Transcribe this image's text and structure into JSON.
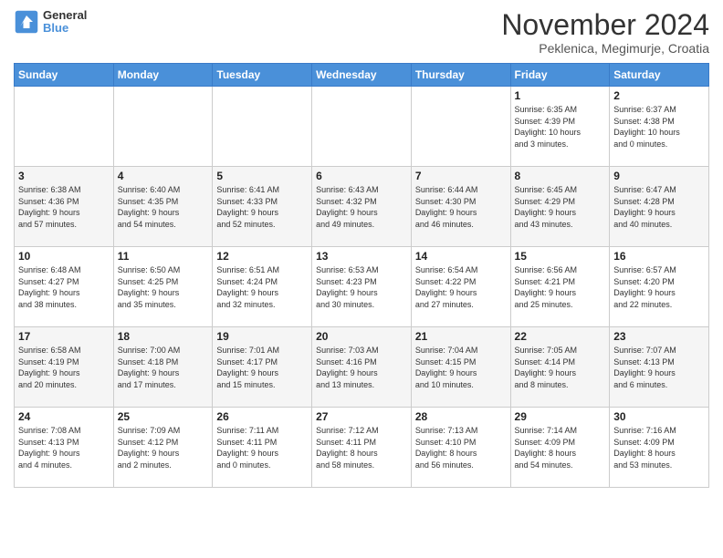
{
  "header": {
    "logo_general": "General",
    "logo_blue": "Blue",
    "month_title": "November 2024",
    "subtitle": "Peklenica, Megimurje, Croatia"
  },
  "days_of_week": [
    "Sunday",
    "Monday",
    "Tuesday",
    "Wednesday",
    "Thursday",
    "Friday",
    "Saturday"
  ],
  "weeks": [
    [
      {
        "day": "",
        "info": ""
      },
      {
        "day": "",
        "info": ""
      },
      {
        "day": "",
        "info": ""
      },
      {
        "day": "",
        "info": ""
      },
      {
        "day": "",
        "info": ""
      },
      {
        "day": "1",
        "info": "Sunrise: 6:35 AM\nSunset: 4:39 PM\nDaylight: 10 hours\nand 3 minutes."
      },
      {
        "day": "2",
        "info": "Sunrise: 6:37 AM\nSunset: 4:38 PM\nDaylight: 10 hours\nand 0 minutes."
      }
    ],
    [
      {
        "day": "3",
        "info": "Sunrise: 6:38 AM\nSunset: 4:36 PM\nDaylight: 9 hours\nand 57 minutes."
      },
      {
        "day": "4",
        "info": "Sunrise: 6:40 AM\nSunset: 4:35 PM\nDaylight: 9 hours\nand 54 minutes."
      },
      {
        "day": "5",
        "info": "Sunrise: 6:41 AM\nSunset: 4:33 PM\nDaylight: 9 hours\nand 52 minutes."
      },
      {
        "day": "6",
        "info": "Sunrise: 6:43 AM\nSunset: 4:32 PM\nDaylight: 9 hours\nand 49 minutes."
      },
      {
        "day": "7",
        "info": "Sunrise: 6:44 AM\nSunset: 4:30 PM\nDaylight: 9 hours\nand 46 minutes."
      },
      {
        "day": "8",
        "info": "Sunrise: 6:45 AM\nSunset: 4:29 PM\nDaylight: 9 hours\nand 43 minutes."
      },
      {
        "day": "9",
        "info": "Sunrise: 6:47 AM\nSunset: 4:28 PM\nDaylight: 9 hours\nand 40 minutes."
      }
    ],
    [
      {
        "day": "10",
        "info": "Sunrise: 6:48 AM\nSunset: 4:27 PM\nDaylight: 9 hours\nand 38 minutes."
      },
      {
        "day": "11",
        "info": "Sunrise: 6:50 AM\nSunset: 4:25 PM\nDaylight: 9 hours\nand 35 minutes."
      },
      {
        "day": "12",
        "info": "Sunrise: 6:51 AM\nSunset: 4:24 PM\nDaylight: 9 hours\nand 32 minutes."
      },
      {
        "day": "13",
        "info": "Sunrise: 6:53 AM\nSunset: 4:23 PM\nDaylight: 9 hours\nand 30 minutes."
      },
      {
        "day": "14",
        "info": "Sunrise: 6:54 AM\nSunset: 4:22 PM\nDaylight: 9 hours\nand 27 minutes."
      },
      {
        "day": "15",
        "info": "Sunrise: 6:56 AM\nSunset: 4:21 PM\nDaylight: 9 hours\nand 25 minutes."
      },
      {
        "day": "16",
        "info": "Sunrise: 6:57 AM\nSunset: 4:20 PM\nDaylight: 9 hours\nand 22 minutes."
      }
    ],
    [
      {
        "day": "17",
        "info": "Sunrise: 6:58 AM\nSunset: 4:19 PM\nDaylight: 9 hours\nand 20 minutes."
      },
      {
        "day": "18",
        "info": "Sunrise: 7:00 AM\nSunset: 4:18 PM\nDaylight: 9 hours\nand 17 minutes."
      },
      {
        "day": "19",
        "info": "Sunrise: 7:01 AM\nSunset: 4:17 PM\nDaylight: 9 hours\nand 15 minutes."
      },
      {
        "day": "20",
        "info": "Sunrise: 7:03 AM\nSunset: 4:16 PM\nDaylight: 9 hours\nand 13 minutes."
      },
      {
        "day": "21",
        "info": "Sunrise: 7:04 AM\nSunset: 4:15 PM\nDaylight: 9 hours\nand 10 minutes."
      },
      {
        "day": "22",
        "info": "Sunrise: 7:05 AM\nSunset: 4:14 PM\nDaylight: 9 hours\nand 8 minutes."
      },
      {
        "day": "23",
        "info": "Sunrise: 7:07 AM\nSunset: 4:13 PM\nDaylight: 9 hours\nand 6 minutes."
      }
    ],
    [
      {
        "day": "24",
        "info": "Sunrise: 7:08 AM\nSunset: 4:13 PM\nDaylight: 9 hours\nand 4 minutes."
      },
      {
        "day": "25",
        "info": "Sunrise: 7:09 AM\nSunset: 4:12 PM\nDaylight: 9 hours\nand 2 minutes."
      },
      {
        "day": "26",
        "info": "Sunrise: 7:11 AM\nSunset: 4:11 PM\nDaylight: 9 hours\nand 0 minutes."
      },
      {
        "day": "27",
        "info": "Sunrise: 7:12 AM\nSunset: 4:11 PM\nDaylight: 8 hours\nand 58 minutes."
      },
      {
        "day": "28",
        "info": "Sunrise: 7:13 AM\nSunset: 4:10 PM\nDaylight: 8 hours\nand 56 minutes."
      },
      {
        "day": "29",
        "info": "Sunrise: 7:14 AM\nSunset: 4:09 PM\nDaylight: 8 hours\nand 54 minutes."
      },
      {
        "day": "30",
        "info": "Sunrise: 7:16 AM\nSunset: 4:09 PM\nDaylight: 8 hours\nand 53 minutes."
      }
    ]
  ]
}
